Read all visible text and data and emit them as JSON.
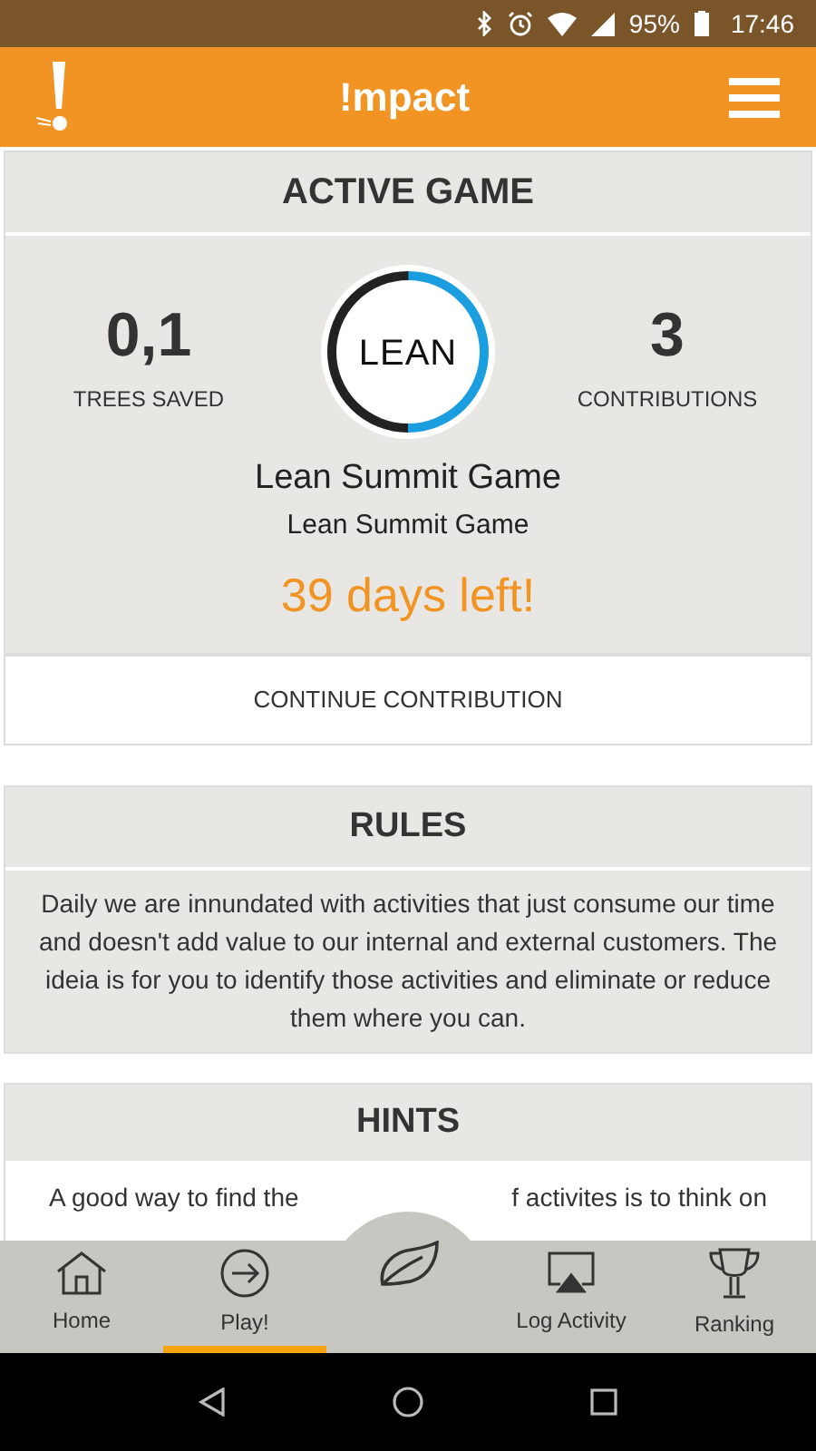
{
  "status_bar": {
    "battery": "95%",
    "time": "17:46"
  },
  "app_bar": {
    "title": "!mpact"
  },
  "active_game": {
    "heading": "ACTIVE GAME",
    "trees_value": "0,1",
    "trees_label": "TREES SAVED",
    "logo_text": "LEAN",
    "contributions_value": "3",
    "contributions_label": "CONTRIBUTIONS",
    "game_title": "Lean Summit Game",
    "game_subtitle": "Lean Summit Game",
    "days_left": "39 days left!",
    "button": "CONTINUE CONTRIBUTION",
    "progress": {
      "level": 0.5
    }
  },
  "rules": {
    "heading": "RULES",
    "text": "Daily we are innundated with activities that just consume our time and doesn't add value to our internal and external customers. The ideia is for you to identify those activities and eliminate or reduce them where you can."
  },
  "hints": {
    "heading": "HINTS",
    "text_fragments": [
      "A good way to find the",
      "f activites is to think on"
    ]
  },
  "bottom_nav": [
    {
      "label": "Home",
      "kind": "home",
      "selected": false
    },
    {
      "label": "Play!",
      "kind": "play",
      "selected": true
    },
    {
      "kind": "leaf",
      "selected": false
    },
    {
      "label": "Log Activity",
      "kind": "log",
      "selected": false
    },
    {
      "label": "Ranking",
      "kind": "ranking",
      "selected": false
    }
  ]
}
